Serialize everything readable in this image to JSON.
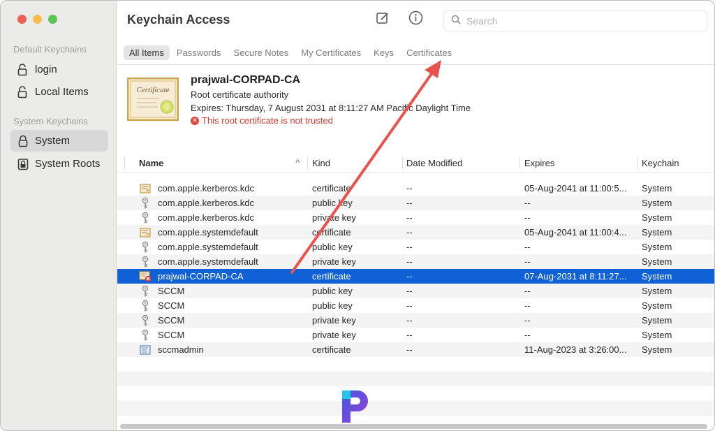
{
  "window": {
    "title": "Keychain Access",
    "traffic_lights": {
      "close": "#ee5f58",
      "minimize": "#f6be4f",
      "zoom": "#5ec454"
    }
  },
  "sidebar": {
    "default_section": "Default Keychains",
    "default_items": [
      {
        "label": "login",
        "icon": "lock-open-icon"
      },
      {
        "label": "Local Items",
        "icon": "lock-open-icon"
      }
    ],
    "system_section": "System Keychains",
    "system_items": [
      {
        "label": "System",
        "icon": "lock-icon",
        "selected": true
      },
      {
        "label": "System Roots",
        "icon": "cabinet-icon"
      }
    ]
  },
  "toolbar": {
    "compose_icon": "compose-icon",
    "info_icon": "info-icon",
    "search_placeholder": "Search"
  },
  "tabs": [
    "All Items",
    "Passwords",
    "Secure Notes",
    "My Certificates",
    "Keys",
    "Certificates"
  ],
  "active_tab": "All Items",
  "detail": {
    "name": "prajwal-CORPAD-CA",
    "type": "Root certificate authority",
    "expires": "Expires: Thursday, 7 August 2031 at 8:11:27 AM Pacific Daylight Time",
    "warning": "This root certificate is not trusted",
    "warning_color": "#d63a2f"
  },
  "table": {
    "columns": {
      "name": "Name",
      "kind": "Kind",
      "date_modified": "Date Modified",
      "expires": "Expires",
      "keychain": "Keychain"
    },
    "rows": [
      {
        "icon": "certificate-icon",
        "name": "com.apple.kerberos.kdc",
        "kind": "certificate",
        "date": "--",
        "expires": "05-Aug-2041 at 11:00:5...",
        "keychain": "System"
      },
      {
        "icon": "key-icon",
        "name": "com.apple.kerberos.kdc",
        "kind": "public key",
        "date": "--",
        "expires": "--",
        "keychain": "System"
      },
      {
        "icon": "key-icon",
        "name": "com.apple.kerberos.kdc",
        "kind": "private key",
        "date": "--",
        "expires": "--",
        "keychain": "System"
      },
      {
        "icon": "certificate-icon",
        "name": "com.apple.systemdefault",
        "kind": "certificate",
        "date": "--",
        "expires": "05-Aug-2041 at 11:00:4...",
        "keychain": "System"
      },
      {
        "icon": "key-icon",
        "name": "com.apple.systemdefault",
        "kind": "public key",
        "date": "--",
        "expires": "--",
        "keychain": "System"
      },
      {
        "icon": "key-icon",
        "name": "com.apple.systemdefault",
        "kind": "private key",
        "date": "--",
        "expires": "--",
        "keychain": "System"
      },
      {
        "icon": "untrusted-certificate-icon",
        "name": "prajwal-CORPAD-CA",
        "kind": "certificate",
        "date": "--",
        "expires": "07-Aug-2031 at 8:11:27...",
        "keychain": "System",
        "selected": true
      },
      {
        "icon": "key-icon",
        "name": "SCCM",
        "kind": "public key",
        "date": "--",
        "expires": "--",
        "keychain": "System"
      },
      {
        "icon": "key-icon",
        "name": "SCCM",
        "kind": "public key",
        "date": "--",
        "expires": "--",
        "keychain": "System"
      },
      {
        "icon": "key-icon",
        "name": "SCCM",
        "kind": "private key",
        "date": "--",
        "expires": "--",
        "keychain": "System"
      },
      {
        "icon": "key-icon",
        "name": "SCCM",
        "kind": "private key",
        "date": "--",
        "expires": "--",
        "keychain": "System"
      },
      {
        "icon": "blue-certificate-icon",
        "name": "sccmadmin",
        "kind": "certificate",
        "date": "--",
        "expires": "11-Aug-2023 at 3:26:00...",
        "keychain": "System"
      }
    ],
    "selection_color": "#1060d6"
  },
  "annotation": {
    "arrow_color": "#e8534d",
    "arrow_icon": "red-arrow-icon"
  },
  "watermark": {
    "icon": "prajwal-logo-icon"
  }
}
